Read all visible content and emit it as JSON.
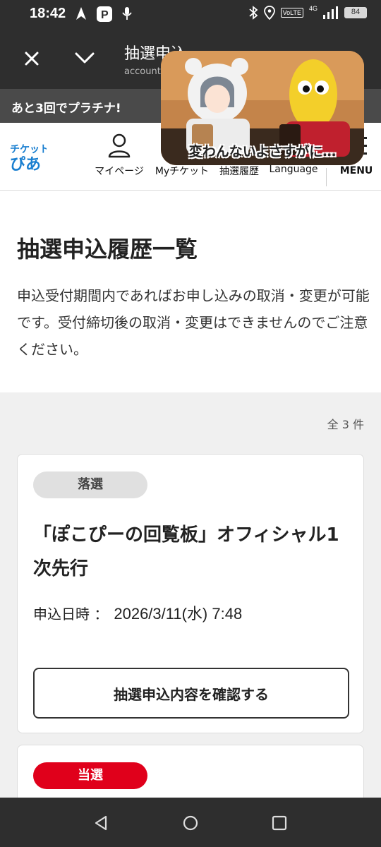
{
  "status_bar": {
    "time": "18:42",
    "network": "4G",
    "volte": "VoLTE",
    "battery": "84"
  },
  "browser": {
    "title": "抽選申込",
    "url": "account"
  },
  "promo": {
    "text": "あと3回でプラチナ!"
  },
  "nav": {
    "mypage": "マイページ",
    "myticket": "Myチケット",
    "history": "抽選履歴",
    "language": "Language",
    "menu": "MENU"
  },
  "overlay": {
    "caption": "変わんないよさすがに…"
  },
  "page": {
    "title": "抽選申込履歴一覧",
    "intro": "申込受付期間内であればお申し込みの取消・変更が可能です。受付締切後の取消・変更はできませんのでご注意ください。"
  },
  "list": {
    "count": "全 3 件",
    "items": [
      {
        "status": "落選",
        "title": "「ぽこぴーの回覧板」オフィシャル1次先行",
        "applied_label": "申込日時 ：",
        "applied_value": "2026/3/11(水) 7:48",
        "button": "抽選申込内容を確認する"
      },
      {
        "status": "当選"
      }
    ]
  },
  "colors": {
    "won": "#e0001b",
    "lost": "#e0e0e0",
    "dark_bar": "#2e2e2e"
  }
}
